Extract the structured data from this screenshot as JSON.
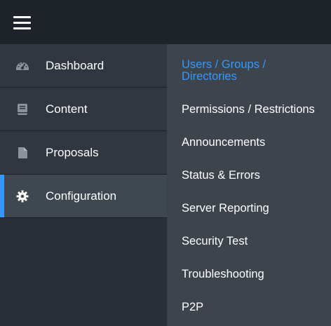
{
  "nav": {
    "items": [
      {
        "label": "Dashboard",
        "icon": "dashboard-gauge-icon"
      },
      {
        "label": "Content",
        "icon": "book-icon"
      },
      {
        "label": "Proposals",
        "icon": "document-icon"
      },
      {
        "label": "Configuration",
        "icon": "gear-icon",
        "active": true
      }
    ]
  },
  "submenu": {
    "items": [
      {
        "label": "Users / Groups / Directories",
        "active": true
      },
      {
        "label": "Permissions / Restrictions"
      },
      {
        "label": "Announcements"
      },
      {
        "label": "Status & Errors"
      },
      {
        "label": "Server Reporting"
      },
      {
        "label": "Security Test"
      },
      {
        "label": "Troubleshooting"
      },
      {
        "label": "P2P"
      }
    ]
  },
  "colors": {
    "accent": "#3399ff",
    "topbar": "#1e232a",
    "sidebar": "#313740",
    "sidebar_active": "#3f4750",
    "submenu": "#3d444c"
  }
}
